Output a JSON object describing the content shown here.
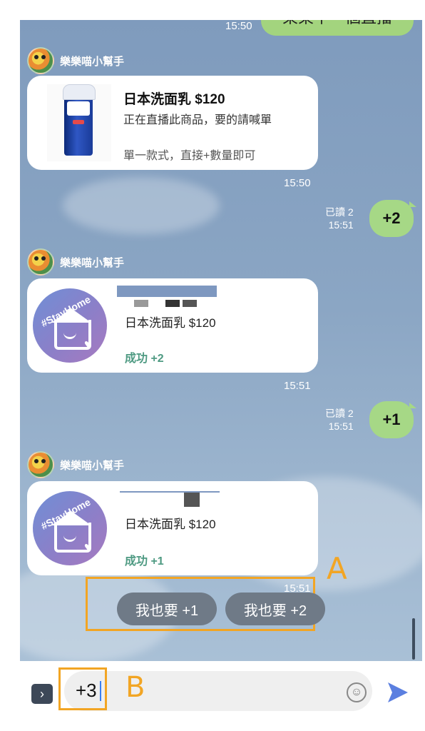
{
  "top": {
    "time": "15:50",
    "partial_text": "東東中一個直播"
  },
  "messages": [
    {
      "sender": "樂樂喵小幫手",
      "product_title": "日本洗面乳 $120",
      "line1": "正在直播此商品，要的請喊單",
      "line2": "單一款式，直接+數量即可",
      "time": "15:50"
    },
    {
      "read": "已讀 2",
      "time": "15:51",
      "text": "+2"
    },
    {
      "sender": "樂樂喵小幫手",
      "stay_label": "#StayHome",
      "product_title": "日本洗面乳 $120",
      "status": "成功 +2",
      "time": "15:51"
    },
    {
      "read": "已讀 2",
      "time": "15:51",
      "text": "+1"
    },
    {
      "sender": "樂樂喵小幫手",
      "stay_label": "#StayHome",
      "product_title": "日本洗面乳 $120",
      "status": "成功 +1",
      "time": "15:51"
    }
  ],
  "quick_replies": [
    "我也要 +1",
    "我也要 +2"
  ],
  "annotations": {
    "a": "A",
    "b": "B"
  },
  "input": {
    "value": "+3"
  },
  "icons": {
    "expand": "chevron-right-icon",
    "emoji": "emoji-icon",
    "send": "send-icon"
  },
  "colors": {
    "accent_orange": "#f2a524",
    "bubble_green": "#a6d886",
    "success_green": "#4e9a82"
  }
}
